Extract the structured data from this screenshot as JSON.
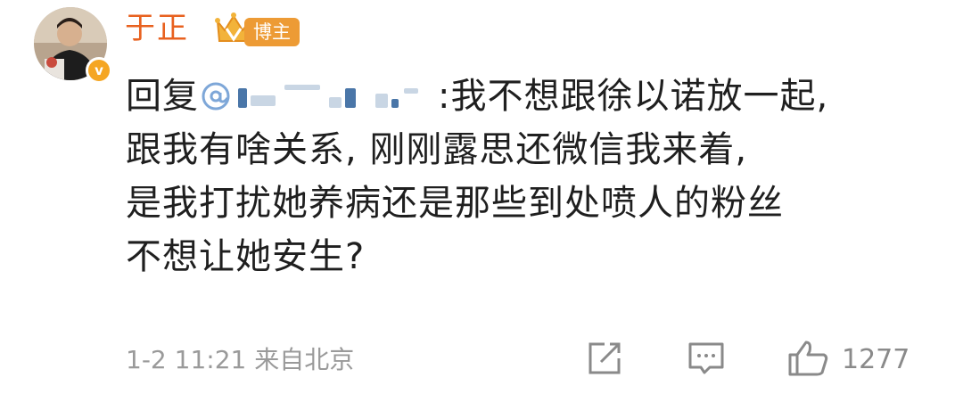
{
  "post": {
    "username": "于正",
    "role_tag": "博主",
    "reply_prefix": "回复",
    "lines": [
      ":我不想跟徐以诺放一起,",
      "跟我有啥关系, 刚刚露思还微信我来着,",
      "是我打扰她养病还是那些到处喷人的粉丝",
      "不想让她安生?"
    ],
    "timestamp": "1-2 11:21",
    "source": "来自北京",
    "like_count": "1277"
  },
  "colors": {
    "username": "#e8611f",
    "badge": "#ed9b35",
    "text": "#1f1f1f",
    "meta": "#9a9a9a",
    "mention": "#4a76a8"
  },
  "icons": [
    "crown-icon",
    "verified-icon",
    "mention-icon",
    "share-icon",
    "comment-icon",
    "like-icon"
  ]
}
